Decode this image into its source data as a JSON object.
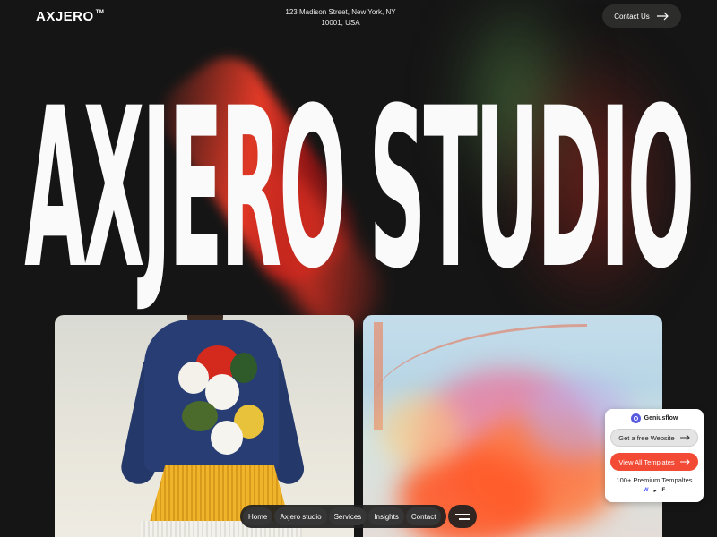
{
  "header": {
    "logo": "AXJERO",
    "logo_tm": "TM",
    "address_line1": "123 Madison Street, New York, NY",
    "address_line2": "10001, USA",
    "contact_label": "Contact Us"
  },
  "hero": {
    "title": "AXJERO STUDIO"
  },
  "nav": {
    "items": [
      "Home",
      "Axjero studio",
      "Services",
      "Insights",
      "Contact"
    ]
  },
  "promo": {
    "brand": "Geniusflow",
    "free_website_label": "Get a free Website",
    "view_templates_label": "View All Templates",
    "templates_count_text": "100+ Premium Tempaltes",
    "platform_icons": [
      "webflow-icon",
      "framer-icon",
      "figma-icon"
    ]
  },
  "colors": {
    "background": "#151515",
    "accent_red": "#f34a35",
    "contact_button_bg": "#2c2d2a",
    "nav_bg": "#202020",
    "promo_brand_icon": "#5a5ce0"
  }
}
